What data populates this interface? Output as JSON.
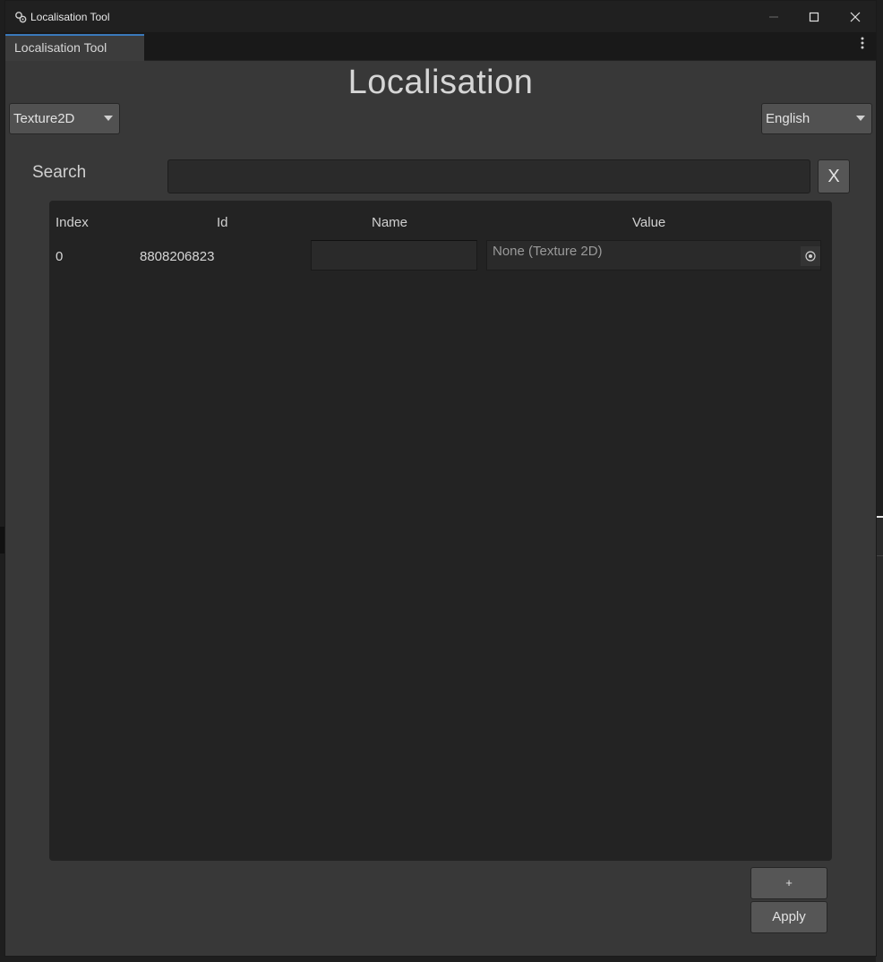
{
  "window": {
    "title": "Localisation Tool"
  },
  "tab": {
    "label": "Localisation Tool",
    "menu_icon": "kebab-menu-icon"
  },
  "header": {
    "title": "Localisation"
  },
  "type_dropdown": {
    "selected": "Texture2D"
  },
  "language_dropdown": {
    "selected": "English"
  },
  "search": {
    "label": "Search",
    "value": "",
    "clear_label": "X"
  },
  "table": {
    "columns": [
      "Index",
      "Id",
      "Name",
      "Value"
    ],
    "rows": [
      {
        "index": "0",
        "id": "8808206823",
        "name": "",
        "value": "None (Texture 2D)"
      }
    ]
  },
  "actions": {
    "add_label": "+",
    "apply_label": "Apply"
  },
  "colors": {
    "window_bg": "#383838",
    "panel_bg": "#232323",
    "titlebar_bg": "#202020",
    "tab_accent": "#3a79bb",
    "button_bg": "#565656"
  }
}
